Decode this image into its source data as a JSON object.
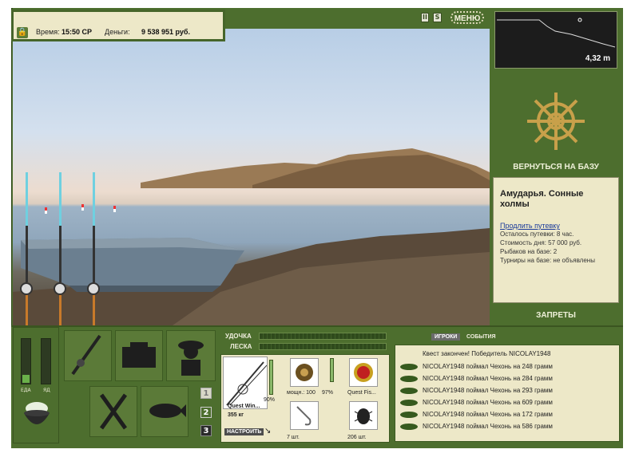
{
  "status": {
    "time_label": "Время:",
    "time_value": "15:50 СР",
    "money_label": "Деньги:",
    "money_value": "9 538 951 руб."
  },
  "toolbar": {
    "pause_label": "II",
    "s_label": "S",
    "menu_label": "МЕНЮ"
  },
  "depth_map": {
    "depth": "4,32 m"
  },
  "location": {
    "back_to_base": "ВЕРНУТЬСЯ НА БАЗУ",
    "title": "Амударья. Сонные холмы",
    "extend_link": "Продлить путевку",
    "lines": [
      "Осталось путевки: 8 час.",
      "Стоимость дня: 57 000 руб.",
      "Рыбаков на базе: 2",
      "Турниры на базе: не объявлены"
    ],
    "bans": "ЗАПРЕТЫ"
  },
  "gauges": {
    "food_label": "ЕДА",
    "food_level": 0.18,
    "poison_label": "ЯД",
    "poison_level": 0.0
  },
  "rod_slots": [
    "1",
    "2",
    "3"
  ],
  "tackle": {
    "rod_label": "УДОЧКА",
    "line_label": "ЛЕСКА",
    "rod_name": "Quest Win...",
    "rod_weight": "355 кг",
    "rod_percent": "90%",
    "setup_button": "НАСТРОИТЬ",
    "reel_caption": "мощн.: 100",
    "reel_percent": "97%",
    "lure_caption": "Quest Fis...",
    "hook_caption": "7 шт.",
    "bait_caption": "206 шт."
  },
  "events": {
    "tab_players": "ИГРОКИ",
    "tab_events": "СОБЫТИЯ",
    "quest": "Квест закончен! Победитель NICOLAY1948",
    "catches": [
      "NICOLAY1948 поймал Чехонь на 248 грамм",
      "NICOLAY1948 поймал Чехонь на 284 грамм",
      "NICOLAY1948 поймал Чехонь на 293 грамм",
      "NICOLAY1948 поймал Чехонь на 609 грамм",
      "NICOLAY1948 поймал Чехонь на 172 грамм",
      "NICOLAY1948 поймал Чехонь на 586 грамм"
    ]
  },
  "colors": {
    "panel_green": "#4d6e2e",
    "panel_cream": "#ede8c8"
  }
}
